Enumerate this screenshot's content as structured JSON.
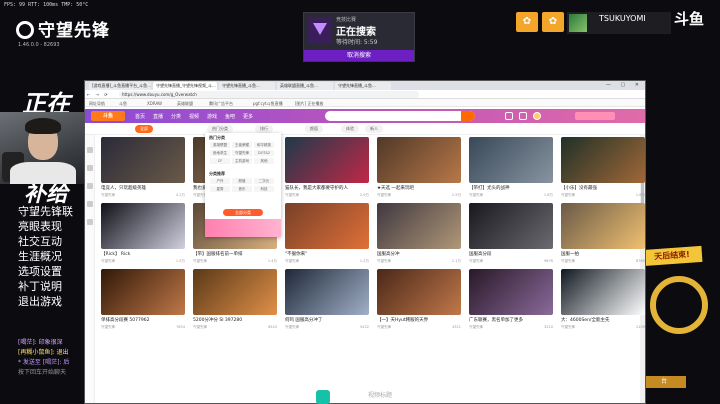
{
  "game": {
    "fps": "FPS: 99  RTT: 100ms  TMP: 50°C",
    "logo": "守望先锋",
    "version": "1.46.0.0 - 82693",
    "big_title": "正在",
    "big_sub": "补给",
    "menu": [
      "守望先锋联",
      "亮眼表现",
      "社交互动",
      "生涯概况",
      "选项设置",
      "补丁说明",
      "退出游戏"
    ],
    "chat": [
      {
        "text": "[喝茫]: 印象很深",
        "color": "c1"
      },
      {
        "text": "[再糊小鼠鱼]: 退出",
        "color": "c2"
      },
      {
        "text": "* 发送至 [喝茫]: 后",
        "color": "c3"
      },
      {
        "text": "按下回车开始聊天",
        "color": "c4"
      }
    ]
  },
  "search_card": {
    "top_label": "竞技比赛",
    "title": "正在搜索",
    "wait": "等待时间: 5:59",
    "cancel": "取消搜索"
  },
  "player": {
    "name": "TSUKUYOMI",
    "sub": "",
    "logo": "斗鱼"
  },
  "right_overlay": {
    "ribbon": "天后结束!",
    "bottom": "台"
  },
  "browser": {
    "tabs": [
      "[游戏直播]_斗鱼直播平台_斗鱼...",
      "守望先锋直播_守望先锋视频_斗...",
      "守望先锋直播_斗鱼...",
      "英雄联盟直播_斗鱼...",
      "守望先锋直播_斗鱼..."
    ],
    "window_controls": "— ▢ ✕",
    "nav": "← → ⟳",
    "url": "https://www.douyu.com/g_Overwatch",
    "bookmarks": [
      "网址导航",
      "斗鱼",
      "XDRAW",
      "英雄联盟",
      "腾讯广告平台",
      "pgf.cyt斗鱼直播",
      "[图片] 正在播放"
    ],
    "site_logo": "斗鱼",
    "site_nav": [
      "首页",
      "直播",
      "分类",
      "视频",
      "游戏",
      "鱼吧",
      "更多"
    ],
    "sub_pills": [
      "全部",
      "热门分类",
      "排行",
      "颜值",
      "体验",
      "新人"
    ],
    "popup": {
      "head": "热门分类",
      "grid": [
        "英雄联盟",
        "王者荣耀",
        "和平精英",
        "绝地求生",
        "守望先锋",
        "DOTA2",
        "CF",
        "主机游戏",
        "其他"
      ],
      "head2": "分类推荐",
      "grid2": [
        "户外",
        "颜值",
        "二次元",
        "星秀",
        "音乐",
        "科技"
      ],
      "more": "全部分类"
    },
    "cards": [
      {
        "t": "电竞人，只玩超级英雄",
        "m": "守望先锋",
        "hot": "4.2万",
        "bg": "linear-gradient(135deg,#2a2a38,#6a5a48)"
      },
      {
        "t": "我也爱玩守望",
        "m": "守望先锋",
        "hot": "3.1万",
        "bg": "linear-gradient(135deg,#4a3a2a,#a08060)"
      },
      {
        "t": "猫队长，我是大家都要守护的人",
        "m": "守望先锋",
        "hot": "2.9万",
        "bg": "linear-gradient(135deg,#1e3a4a,#c02848)"
      },
      {
        "t": "★天选 一起来玩吧",
        "m": "守望先锋",
        "hot": "2.5万",
        "bg": "linear-gradient(135deg,#503828,#b87848)"
      },
      {
        "t": "【带打】尤头的战神",
        "m": "守望先锋",
        "hot": "1.8万",
        "bg": "linear-gradient(135deg,#384858,#8894a0)"
      },
      {
        "t": "【小乐】没有最强",
        "m": "守望先锋",
        "hot": "1.6万",
        "bg": "linear-gradient(135deg,#203028,#a06838)"
      },
      {
        "t": "【Rick】 Rick",
        "m": "守望先锋",
        "hot": "1.5万",
        "bg": "linear-gradient(135deg,#101018,#d0d0e0)"
      },
      {
        "t": "【带】国服排名前一单排",
        "m": "守望先锋",
        "hot": "1.4万",
        "bg": "linear-gradient(135deg,#5a4838,#d8b080)"
      },
      {
        "t": "\"不服你来\"",
        "m": "守望先锋",
        "hot": "1.2万",
        "bg": "linear-gradient(135deg,#784028,#e07038)"
      },
      {
        "t": "国服高分冲",
        "m": "守望先锋",
        "hot": "1.1万",
        "bg": "linear-gradient(135deg,#403840,#b09878)"
      },
      {
        "t": "国服高分段",
        "m": "守望先锋",
        "hot": "9876",
        "bg": "linear-gradient(135deg,#18181e,#6a6a70)"
      },
      {
        "t": "国服一拍",
        "m": "守望先锋",
        "hot": "8765",
        "bg": "linear-gradient(135deg,#6a5a48,#f0c070)"
      },
      {
        "t": "单排高分段赛 5077962",
        "m": "守望先锋",
        "hot": "7654",
        "bg": "linear-gradient(135deg,#301808,#c07848)"
      },
      {
        "t": "5200分冲分 Sl 397280",
        "m": "守望先锋",
        "hot": "6543",
        "bg": "linear-gradient(135deg,#5a3818,#e09048)"
      },
      {
        "t": "何鸣 国服高分冲了",
        "m": "守望先锋",
        "hot": "5432",
        "bg": "linear-gradient(135deg,#202838,#a0b0c8)"
      },
      {
        "t": "【一】天Hyut韩服的天界",
        "m": "守望先锋",
        "hot": "4321",
        "bg": "linear-gradient(135deg,#4a2818,#c0784a)"
      },
      {
        "t": "广东联赛，黑名单加了更多",
        "m": "守望先锋",
        "hot": "3210",
        "bg": "linear-gradient(135deg,#281828,#8a6a9a)"
      },
      {
        "t": "大：4600Sen/全能主先",
        "m": "守望先锋",
        "hot": "2109",
        "bg": "linear-gradient(135deg,#101820,#ffffff)"
      }
    ]
  },
  "bottom_caption": "视频标题"
}
